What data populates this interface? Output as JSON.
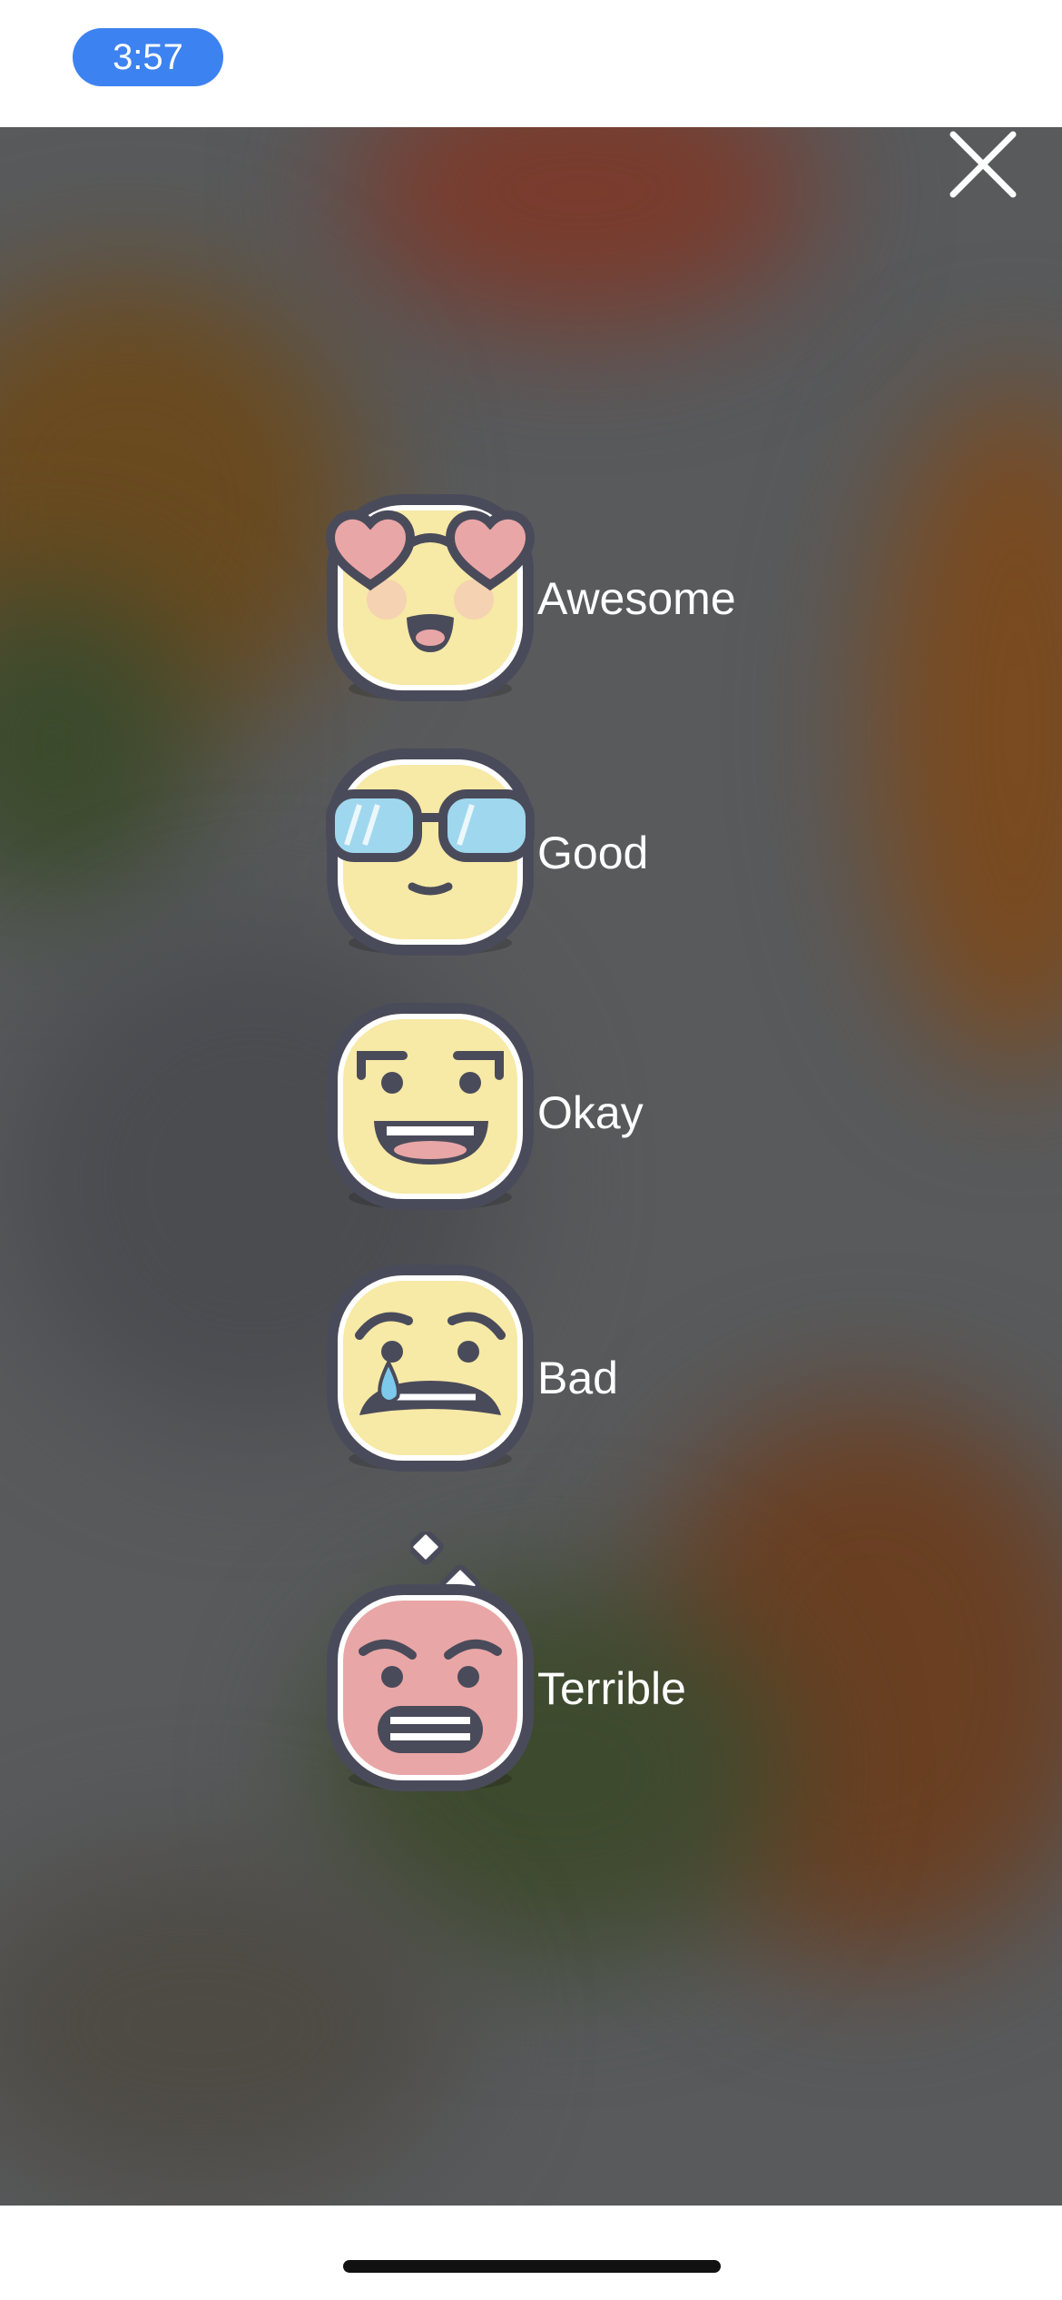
{
  "status_bar": {
    "time": "3:57",
    "accent": "#3d82f1"
  },
  "overlay": {
    "close_icon": "close-icon",
    "moods": [
      {
        "label": "Awesome",
        "icon": "heart-eyes-face-icon"
      },
      {
        "label": "Good",
        "icon": "sunglasses-face-icon"
      },
      {
        "label": "Okay",
        "icon": "grinning-face-icon"
      },
      {
        "label": "Bad",
        "icon": "crying-face-icon"
      },
      {
        "label": "Terrible",
        "icon": "angry-face-icon"
      }
    ]
  },
  "colors": {
    "face_yellow": "#f7e9a6",
    "face_red": "#e9a6a6",
    "outline": "#4a4b5a"
  }
}
